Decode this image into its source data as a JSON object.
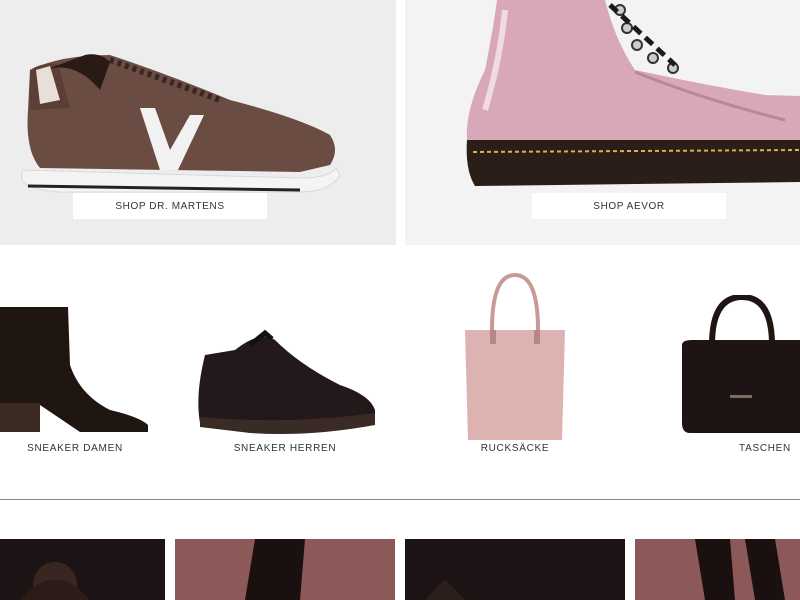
{
  "hero": {
    "left": {
      "button_label": "SHOP DR. MARTENS",
      "image": "sneaker-brown"
    },
    "right": {
      "button_label": "SHOP AEVOR",
      "image": "boot-pink"
    }
  },
  "categories": [
    {
      "label": "SNEAKER DAMEN",
      "icon": "ankle-boot-icon"
    },
    {
      "label": "SNEAKER HERREN",
      "icon": "sneaker-icon"
    },
    {
      "label": "RUCKSÄCKE",
      "icon": "tote-bag-icon"
    },
    {
      "label": "TASCHEN",
      "icon": "handbag-icon"
    }
  ],
  "colors": {
    "hero_bg_left": "#ededed",
    "hero_bg_right": "#f3f3f3",
    "dark_tile": "#1c1414",
    "rose_tile": "#8c5858"
  }
}
